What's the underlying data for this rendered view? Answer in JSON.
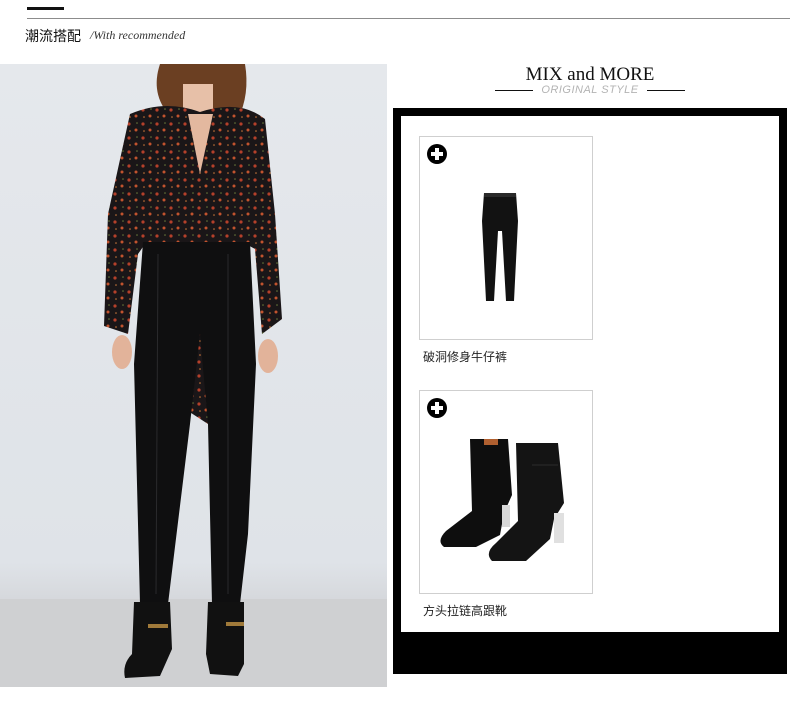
{
  "header": {
    "title": "潮流搭配",
    "subtitle": "/With recommended"
  },
  "mix": {
    "title": "MIX and MORE",
    "subtitle": "ORIGINAL STYLE"
  },
  "products": [
    {
      "name": "破洞修身牛仔裤",
      "icon": "jeans-icon"
    },
    {
      "name": "方头拉链高跟靴",
      "icon": "ankle-boots-icon"
    }
  ],
  "colors": {
    "frame": "#000000",
    "subtitle_gray": "#b3b3b3"
  }
}
